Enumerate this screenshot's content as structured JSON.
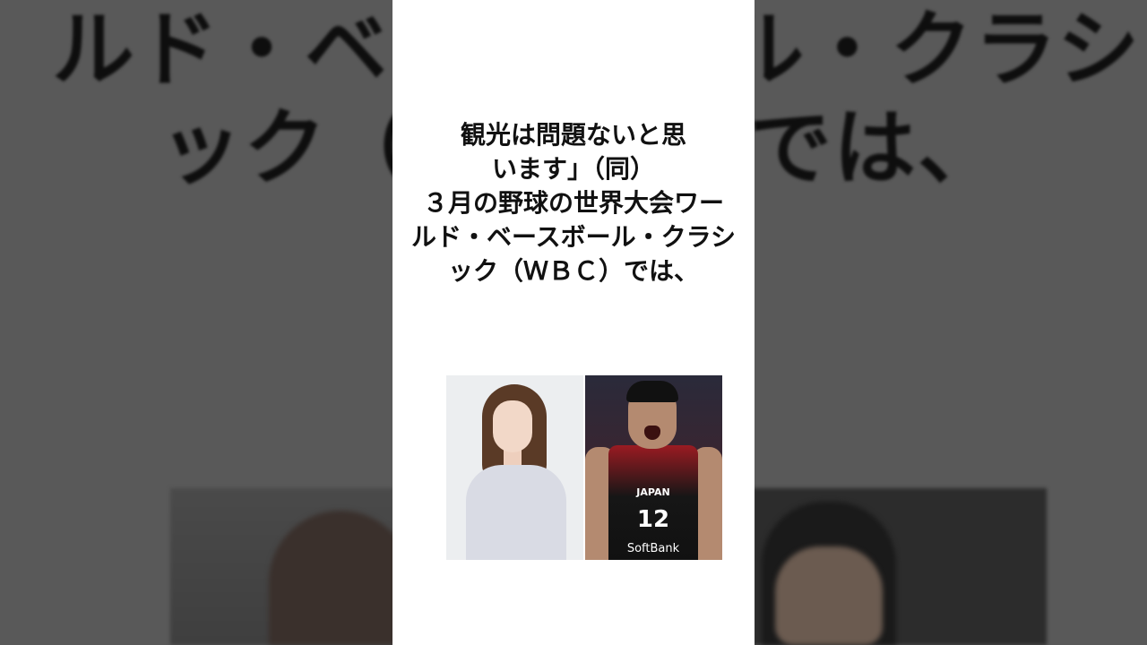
{
  "background_text": {
    "line1": "ルド・ベースボール・クラシ",
    "line2": "ック（ＷＢＣ）では、"
  },
  "caption": {
    "line1": "観光は問題ないと思",
    "line2": "います」（同）",
    "line3": "３月の野球の世界大会ワー",
    "line4": "ルド・ベースボール・クラシ",
    "line5": "ック（ＷＢＣ）では、"
  },
  "photo_right": {
    "team": "JAPAN",
    "number": "12",
    "sponsor": "SoftBank"
  },
  "colors": {
    "panel": "#ffffff",
    "background": "#595959",
    "jersey_red": "#9a1b22"
  }
}
